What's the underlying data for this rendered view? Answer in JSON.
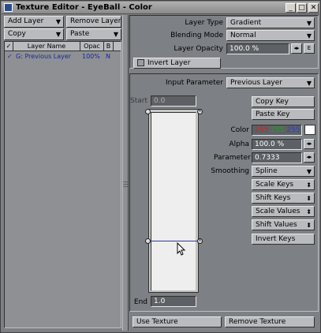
{
  "window": {
    "title": "Texture Editor - EyeBall - Color",
    "minimize": "_",
    "maximize": "□",
    "close": "✕"
  },
  "toolbar": {
    "add_layer": "Add Layer",
    "remove_layer": "Remove Layer",
    "copy": "Copy",
    "paste": "Paste"
  },
  "layer_list": {
    "columns": [
      "Layer Name",
      "Opac",
      "B"
    ],
    "rows": [
      {
        "check": "✓",
        "name": "G: Previous Layer",
        "opacity": "100%",
        "blend": "N"
      }
    ]
  },
  "layer_props": {
    "layer_type_label": "Layer Type",
    "layer_type_value": "Gradient",
    "blending_mode_label": "Blending Mode",
    "blending_mode_value": "Normal",
    "layer_opacity_label": "Layer Opacity",
    "layer_opacity_value": "100.0 %",
    "invert_layer": "Invert Layer"
  },
  "gradient": {
    "input_parameter_label": "Input Parameter",
    "input_parameter_value": "Previous Layer",
    "start_label": "Start",
    "start_value": "0.0",
    "end_label": "End",
    "end_value": "1.0",
    "copy_key": "Copy Key",
    "paste_key": "Paste Key",
    "color_label": "Color",
    "color_r": "255",
    "color_g": "255",
    "color_b": "255",
    "alpha_label": "Alpha",
    "alpha_value": "100.0 %",
    "parameter_label": "Parameter",
    "parameter_value": "0.7333",
    "smoothing_label": "Smoothing",
    "smoothing_value": "Spline",
    "scale_keys": "Scale Keys",
    "shift_keys": "Shift Keys",
    "scale_values": "Scale Values",
    "shift_values": "Shift Values",
    "invert_keys": "Invert Keys"
  },
  "footer": {
    "use_texture": "Use Texture",
    "remove_texture": "Remove Texture"
  },
  "colors": {
    "color_r": "#d42020",
    "color_g": "#20a020",
    "color_b": "#3040d0"
  }
}
